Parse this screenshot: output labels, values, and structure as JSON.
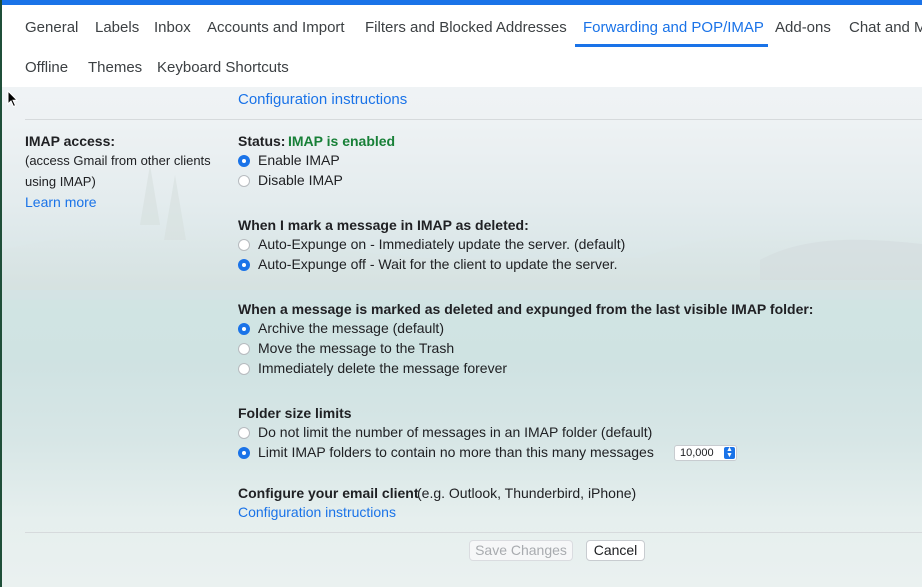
{
  "tabs": {
    "row1": [
      "General",
      "Labels",
      "Inbox",
      "Accounts and Import",
      "Filters and Blocked Addresses",
      "Forwarding and POP/IMAP",
      "Add-ons",
      "Chat and M"
    ],
    "row2": [
      "Offline",
      "Themes",
      "Keyboard Shortcuts"
    ],
    "active": "Forwarding and POP/IMAP"
  },
  "pop": {
    "config_link": "Configuration instructions"
  },
  "imap": {
    "title": "IMAP access:",
    "desc_line1": "(access Gmail from other clients",
    "desc_line2": "using IMAP)",
    "learn_more": "Learn more",
    "status_label": "Status:",
    "status_value": "IMAP is enabled",
    "enable": "Enable IMAP",
    "disable": "Disable IMAP",
    "deleted_heading": "When I mark a message in IMAP as deleted:",
    "expunge_on": "Auto-Expunge on - Immediately update the server. (default)",
    "expunge_off": "Auto-Expunge off - Wait for the client to update the server.",
    "expunged_heading": "When a message is marked as deleted and expunged from the last visible IMAP folder:",
    "archive": "Archive the message (default)",
    "trash": "Move the message to the Trash",
    "delete_forever": "Immediately delete the message forever",
    "folder_heading": "Folder size limits",
    "no_limit": "Do not limit the number of messages in an IMAP folder (default)",
    "limit": "Limit IMAP folders to contain no more than this many messages",
    "limit_value": "10,000",
    "client_heading": "Configure your email client",
    "client_examples": "(e.g. Outlook, Thunderbird, iPhone)",
    "config_link": "Configuration instructions"
  },
  "selections": {
    "imap_enabled": true,
    "auto_expunge": "off",
    "expunge_action": "archive",
    "folder_limit": "limit"
  },
  "buttons": {
    "save": "Save Changes",
    "cancel": "Cancel"
  },
  "colors": {
    "accent": "#1a73e8",
    "status_green": "#188038"
  }
}
